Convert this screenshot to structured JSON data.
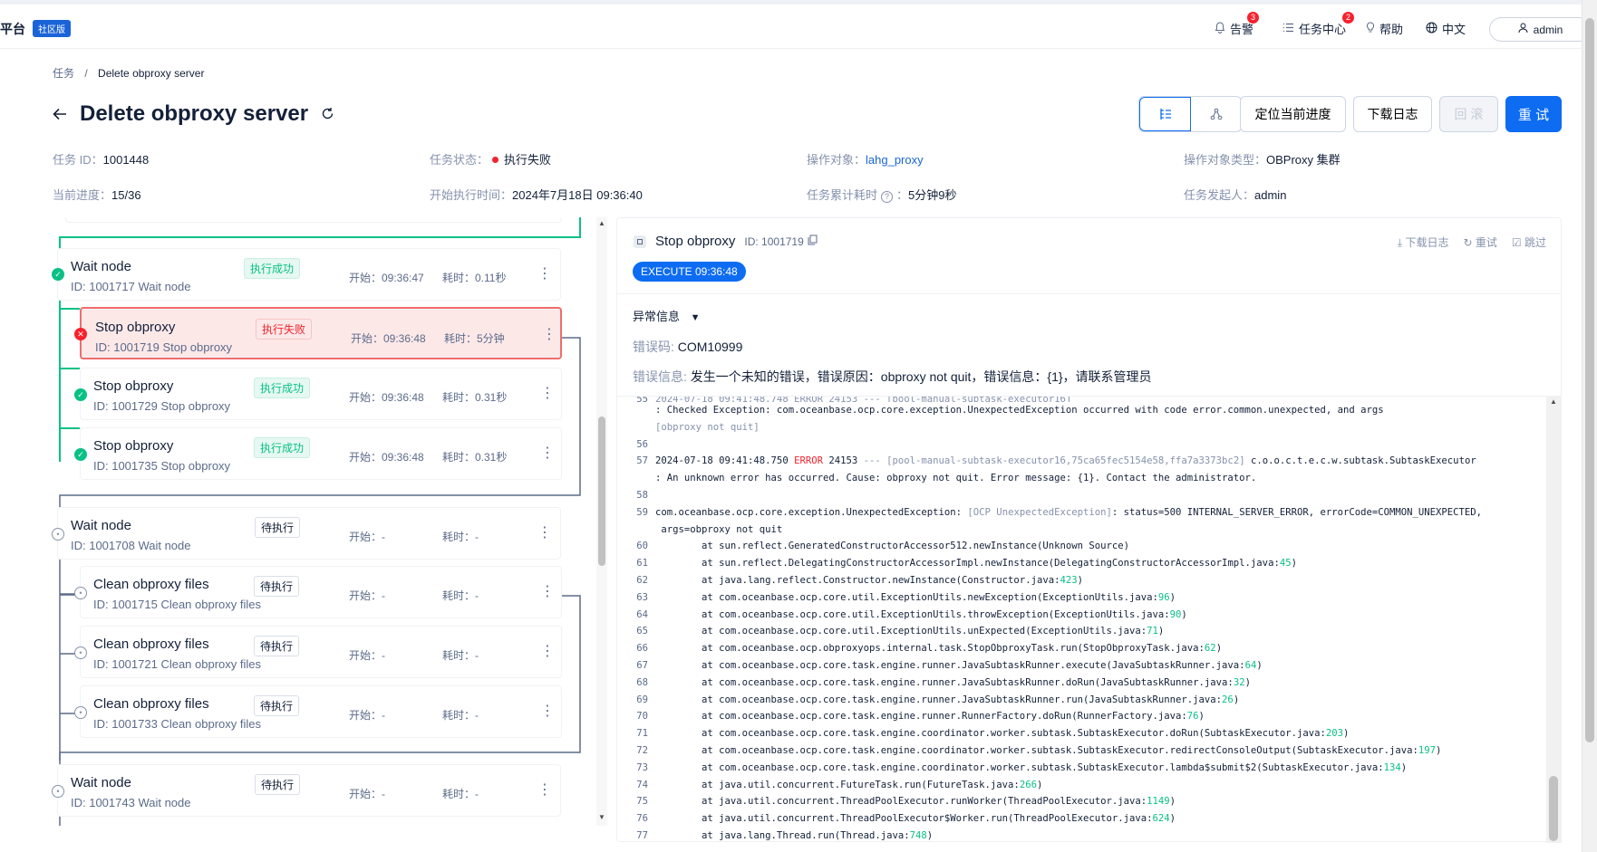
{
  "topbar": {
    "brand": "平台",
    "edition": "社区版",
    "alerts_label": "告警",
    "alerts_count": "3",
    "tasks_label": "任务中心",
    "tasks_count": "2",
    "help_label": "帮助",
    "lang_label": "中文",
    "user_label": "admin"
  },
  "breadcrumb": {
    "parent": "任务",
    "sep": "/",
    "current": "Delete obproxy server"
  },
  "page": {
    "title": "Delete obproxy server"
  },
  "actions": {
    "locate": "定位当前进度",
    "download": "下载日志",
    "rollback": "回 滚",
    "retry": "重 试"
  },
  "info": {
    "task_id_k": "任务 ID：",
    "task_id_v": "1001448",
    "status_k": "任务状态：",
    "status_v": "执行失败",
    "target_k": "操作对象：",
    "target_v": "lahg_proxy",
    "target_type_k": "操作对象类型：",
    "target_type_v": "OBProxy 集群",
    "progress_k": "当前进度：",
    "progress_v": "15/36",
    "start_k": "开始执行时间：",
    "start_v": "2024年7月18日 09:36:40",
    "elapsed_k": "任务累计耗时",
    "elapsed_v": "5分钟9秒",
    "creator_k": "任务发起人：",
    "creator_v": "admin"
  },
  "nodes": [
    {
      "name": "Wait node",
      "id": "ID: 1001717  Wait node",
      "tag": "执行成功",
      "start": "开始：09:36:47",
      "cost": "耗时：0.11秒"
    },
    {
      "name": "Stop obproxy",
      "id": "ID: 1001719  Stop obproxy",
      "tag": "执行失败",
      "start": "开始：09:36:48",
      "cost": "耗时：5分钟"
    },
    {
      "name": "Stop obproxy",
      "id": "ID: 1001729  Stop obproxy",
      "tag": "执行成功",
      "start": "开始：09:36:48",
      "cost": "耗时：0.31秒"
    },
    {
      "name": "Stop obproxy",
      "id": "ID: 1001735  Stop obproxy",
      "tag": "执行成功",
      "start": "开始：09:36:48",
      "cost": "耗时：0.31秒"
    },
    {
      "name": "Wait node",
      "id": "ID: 1001708  Wait node",
      "tag": "待执行",
      "start": "开始：-",
      "cost": "耗时：-"
    },
    {
      "name": "Clean obproxy files",
      "id": "ID: 1001715  Clean obproxy files",
      "tag": "待执行",
      "start": "开始：-",
      "cost": "耗时：-"
    },
    {
      "name": "Clean obproxy files",
      "id": "ID: 1001721  Clean obproxy files",
      "tag": "待执行",
      "start": "开始：-",
      "cost": "耗时：-"
    },
    {
      "name": "Clean obproxy files",
      "id": "ID: 1001733  Clean obproxy files",
      "tag": "待执行",
      "start": "开始：-",
      "cost": "耗时：-"
    },
    {
      "name": "Wait node",
      "id": "ID: 1001743  Wait node",
      "tag": "待执行",
      "start": "开始：-",
      "cost": "耗时：-"
    }
  ],
  "detail": {
    "title": "Stop obproxy",
    "id": "ID: 1001719",
    "tool_download": "下载日志",
    "tool_retry": "重试",
    "tool_skip": "跳过",
    "exec_badge": "EXECUTE 09:36:48",
    "exc_title": "异常信息",
    "err_code_k": "错误码:",
    "err_code_v": "COM10999",
    "err_msg_k": "错误信息:",
    "err_msg_v": "发生一个未知的错误，错误原因：obproxy not quit，错误信息：{1}，请联系管理员"
  },
  "log": {
    "l55a": ": Checked Exception: com.oceanbase.ocp.core.exception.UnexpectedException occurred with code error.common.unexpected, and args",
    "l55b": "[obproxy not quit]",
    "n56": "56",
    "n57": "57",
    "l57_ts": "2024-07-18 09:41:48.750 ",
    "l57_lvl": "ERROR",
    "l57_pid": " 24153 ",
    "l57_thr": "--- [pool-manual-subtask-executor16,75ca65fec5154e58,ffa7a3373bc2]",
    "l57_cls": " c.o.o.c.t.e.c.w.subtask.SubtaskExecutor",
    "l57b": ": An unknown error has occurred. Cause: obproxy not quit. Error message: {1}. Contact the administrator.",
    "n58": "58",
    "n59": "59",
    "l59_a": "com.oceanbase.ocp.core.exception.UnexpectedException: ",
    "l59_b": "[OCP UnexpectedException]",
    "l59_c": ": status=500 INTERNAL_SERVER_ERROR, errorCode=COMMON_UNEXPECTED,",
    "l59b": " args=obproxy not quit",
    "stack": [
      {
        "n": "60",
        "t": "        at sun.reflect.GeneratedConstructorAccessor512.newInstance(Unknown Source)"
      },
      {
        "n": "61",
        "t": "        at sun.reflect.DelegatingConstructorAccessorImpl.newInstance(DelegatingConstructorAccessorImpl.java:45)"
      },
      {
        "n": "62",
        "t": "        at java.lang.reflect.Constructor.newInstance(Constructor.java:423)"
      },
      {
        "n": "63",
        "t": "        at com.oceanbase.ocp.core.util.ExceptionUtils.newException(ExceptionUtils.java:96)"
      },
      {
        "n": "64",
        "t": "        at com.oceanbase.ocp.core.util.ExceptionUtils.throwException(ExceptionUtils.java:90)"
      },
      {
        "n": "65",
        "t": "        at com.oceanbase.ocp.core.util.ExceptionUtils.unExpected(ExceptionUtils.java:71)"
      },
      {
        "n": "66",
        "t": "        at com.oceanbase.ocp.obproxyops.internal.task.StopObproxyTask.run(StopObproxyTask.java:62)"
      },
      {
        "n": "67",
        "t": "        at com.oceanbase.ocp.core.task.engine.runner.JavaSubtaskRunner.execute(JavaSubtaskRunner.java:64)"
      },
      {
        "n": "68",
        "t": "        at com.oceanbase.ocp.core.task.engine.runner.JavaSubtaskRunner.doRun(JavaSubtaskRunner.java:32)"
      },
      {
        "n": "69",
        "t": "        at com.oceanbase.ocp.core.task.engine.runner.JavaSubtaskRunner.run(JavaSubtaskRunner.java:26)"
      },
      {
        "n": "70",
        "t": "        at com.oceanbase.ocp.core.task.engine.runner.RunnerFactory.doRun(RunnerFactory.java:76)"
      },
      {
        "n": "71",
        "t": "        at com.oceanbase.ocp.core.task.engine.coordinator.worker.subtask.SubtaskExecutor.doRun(SubtaskExecutor.java:203)"
      },
      {
        "n": "72",
        "t": "        at com.oceanbase.ocp.core.task.engine.coordinator.worker.subtask.SubtaskExecutor.redirectConsoleOutput(SubtaskExecutor.java:197)"
      },
      {
        "n": "73",
        "t": "        at com.oceanbase.ocp.core.task.engine.coordinator.worker.subtask.SubtaskExecutor.lambda$submit$2(SubtaskExecutor.java:134)"
      },
      {
        "n": "74",
        "t": "        at java.util.concurrent.FutureTask.run(FutureTask.java:266)"
      },
      {
        "n": "75",
        "t": "        at java.util.concurrent.ThreadPoolExecutor.runWorker(ThreadPoolExecutor.java:1149)"
      },
      {
        "n": "76",
        "t": "        at java.util.concurrent.ThreadPoolExecutor$Worker.run(ThreadPoolExecutor.java:624)"
      },
      {
        "n": "77",
        "t": "        at java.lang.Thread.run(Thread.java:748)"
      }
    ]
  },
  "colors": {
    "primary": "#0d6cf2",
    "success": "#0ac185",
    "error": "#f5222d",
    "muted": "#8592ad"
  }
}
